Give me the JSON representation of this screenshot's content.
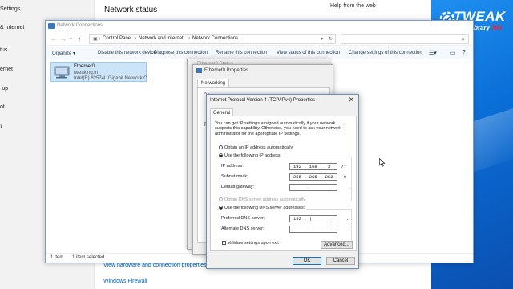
{
  "settings": {
    "nav": [
      "Settings",
      "& Internet",
      "tus",
      "ernet",
      "-up",
      "ot",
      "y"
    ],
    "title": "Network status",
    "help_title": "Help from the web",
    "links": [
      "View hardware and connection properties",
      "Windows Firewall"
    ]
  },
  "logo": {
    "word": "TWEAK",
    "sub_a": "Library",
    "sub_b": "Net"
  },
  "netconn": {
    "title": "Network Connections",
    "breadcrumbs": [
      "Control Panel",
      "Network and Internet",
      "Network Connections"
    ],
    "toolbar": [
      "Organize ▾",
      "Disable this network device",
      "Diagnose this connection",
      "Rename this connection",
      "View status of this connection",
      "Change settings of this connection"
    ],
    "adapter": {
      "name": "Ethernet0",
      "network": "tweaking.in",
      "device": "Intel(R) 82574L Gigabit Network C..."
    },
    "status_count": "1 item",
    "status_selected": "1 item selected"
  },
  "ethstatus": {
    "title": "Ethernet0 Status"
  },
  "ethprops": {
    "title": "Ethernet0 Properties",
    "tab": "Networking",
    "frag_a": "Co",
    "frag_b": "Th"
  },
  "ipv4": {
    "title": "Internet Protocol Version 4 (TCP/IPv4) Properties",
    "tab": "General",
    "description": "You can get IP settings assigned automatically if your network supports this capability. Otherwise, you need to ask your network administrator for the appropriate IP settings.",
    "auto_ip_label": "Obtain an IP address automatically",
    "manual_ip_label": "Use the following IP address:",
    "ip_label": "IP address:",
    "ip_value": "192 . 168 .  3  . 77",
    "mask_label": "Subnet mask:",
    "mask_value": "255 . 255 . 252 .  0",
    "gateway_label": "Default gateway:",
    "gateway_value": "     .       .       .",
    "auto_dns_label": "Obtain DNS server address automatically",
    "manual_dns_label": "Use the following DNS server addresses:",
    "pref_dns_label": "Preferred DNS server:",
    "pref_dns_value": "192 . |      .      .",
    "alt_dns_label": "Alternate DNS server:",
    "alt_dns_value": "     .       .       .",
    "validate_label": "Validate settings upon exit",
    "advanced_label": "Advanced...",
    "ok_label": "OK",
    "cancel_label": "Cancel"
  }
}
